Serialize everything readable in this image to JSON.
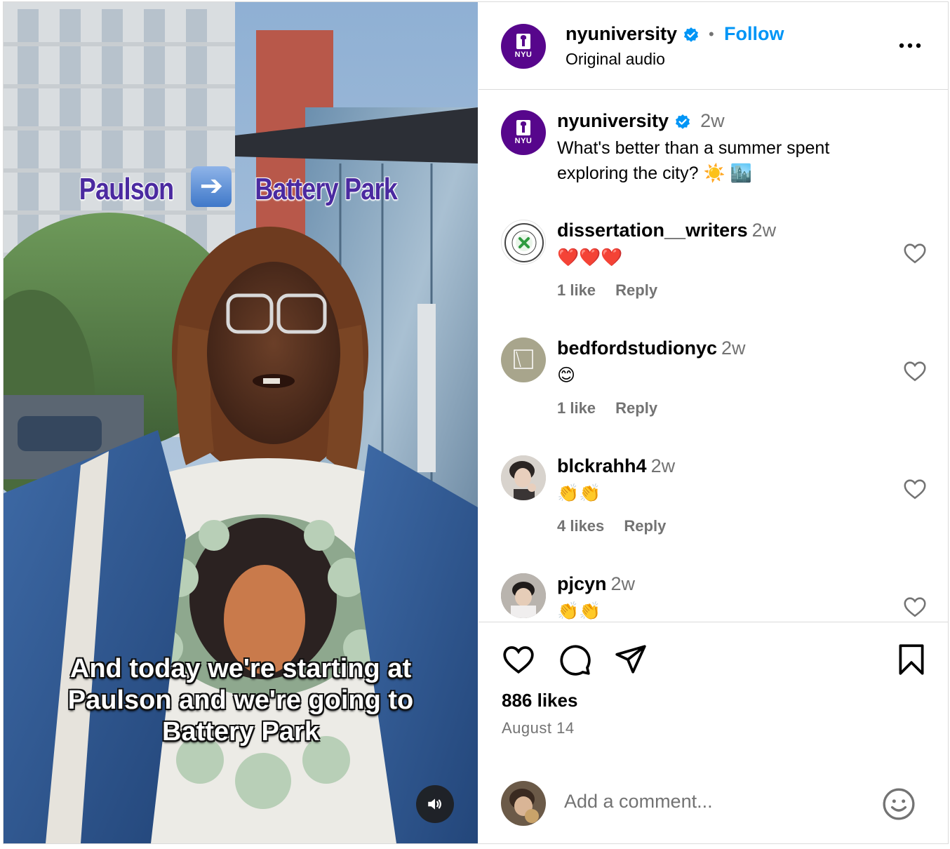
{
  "video": {
    "top_caption_left": "Paulson",
    "top_caption_right": "Battery Park",
    "subtitle": "And today we're starting at Paulson and we're going to Battery Park"
  },
  "header": {
    "username": "nyuniversity",
    "avatar_text": "NYU",
    "separator": "•",
    "follow_label": "Follow",
    "audio_label": "Original audio",
    "more_label": "..."
  },
  "caption": {
    "username": "nyuniversity",
    "time": "2w",
    "text": "What's better than a summer spent exploring the city? ☀️ 🏙️"
  },
  "comments": [
    {
      "username": "dissertation__writers",
      "time": "2w",
      "text": "❤️❤️❤️",
      "likes": "1 like",
      "reply": "Reply"
    },
    {
      "username": "bedfordstudionyc",
      "time": "2w",
      "text": "😊",
      "likes": "1 like",
      "reply": "Reply"
    },
    {
      "username": "blckrahh4",
      "time": "2w",
      "text": "👏👏",
      "likes": "4 likes",
      "reply": "Reply"
    },
    {
      "username": "pjcyn",
      "time": "2w",
      "text": "👏👏",
      "likes": "",
      "reply": ""
    }
  ],
  "footer": {
    "likes": "886 likes",
    "date": "August 14",
    "add_comment_placeholder": "Add a comment..."
  },
  "icons": {
    "like": "heart-icon",
    "comment": "comment-bubble-icon",
    "share": "paper-plane-icon",
    "save": "bookmark-icon",
    "emoji": "smiley-icon",
    "mute": "speaker-icon",
    "verified": "verified-badge-icon"
  },
  "colors": {
    "brand_purple": "#57068c",
    "follow_blue": "#0095f6",
    "secondary_text": "#737373",
    "divider": "#dbdbdb",
    "heart_red": "#e0245e"
  }
}
